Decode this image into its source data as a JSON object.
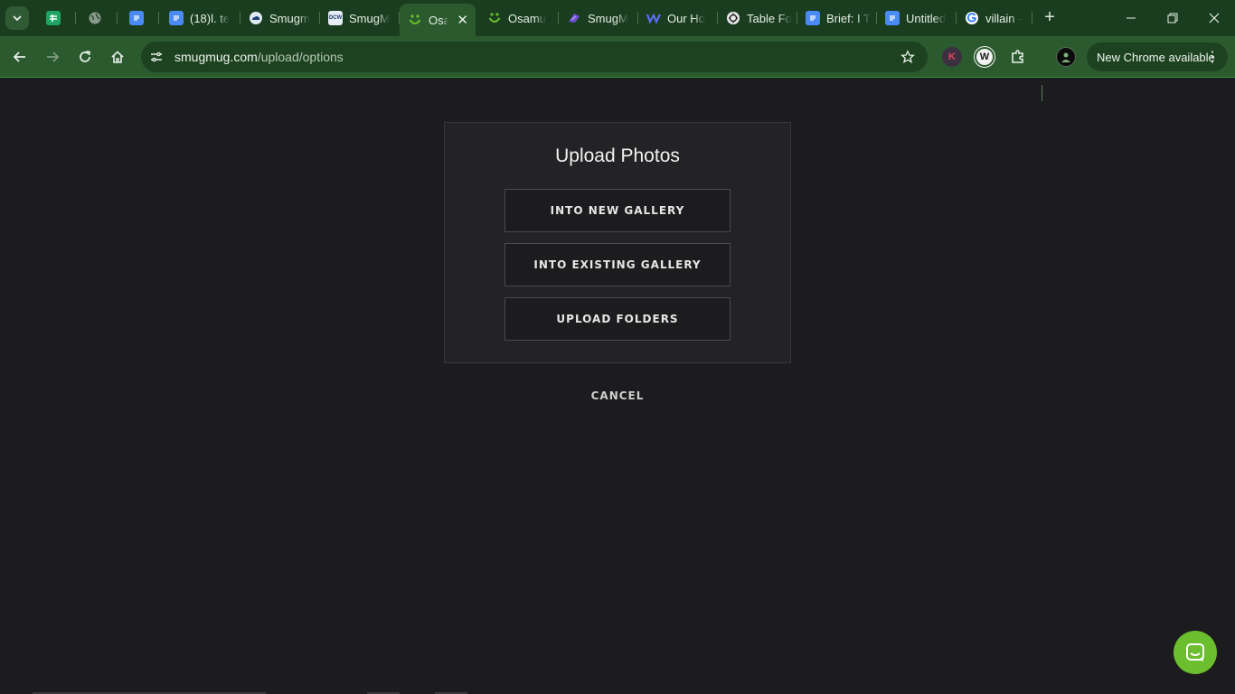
{
  "browser": {
    "tabs": [
      {
        "icon": "sheets-icon",
        "label": ""
      },
      {
        "icon": "globe-icon",
        "label": ""
      },
      {
        "icon": "docs-icon",
        "label": ""
      },
      {
        "icon": "docs-icon",
        "label": "(18)l. te"
      },
      {
        "icon": "cloud-icon",
        "label": "Smugm"
      },
      {
        "icon": "dcw-icon",
        "label": "SmugM"
      },
      {
        "icon": "smugmug-icon",
        "label": "Osa",
        "active": true
      },
      {
        "icon": "smugmug-icon",
        "label": "Osamu"
      },
      {
        "icon": "purple-logo-icon",
        "label": "SmugM"
      },
      {
        "icon": "w-logo-icon",
        "label": "Our Ho"
      },
      {
        "icon": "openai-icon",
        "label": "Table Fo"
      },
      {
        "icon": "docs-icon",
        "label": "Brief: I T"
      },
      {
        "icon": "docs-icon",
        "label": "Untitled"
      },
      {
        "icon": "google-icon",
        "label": "villain -"
      }
    ],
    "url_domain": "smugmug.com",
    "url_path": "/upload/options",
    "update_label": "New Chrome available",
    "ext_k_label": "K",
    "ext_w_label": "W"
  },
  "upload": {
    "title": "Upload Photos",
    "options": {
      "new_gallery": "INTO NEW GALLERY",
      "existing_gallery": "INTO EXISTING GALLERY",
      "folders": "UPLOAD FOLDERS"
    },
    "cancel": "CANCEL"
  },
  "colors": {
    "accent": "#6bbf2e",
    "frame": "#2b5a2f",
    "background": "#1c1c1e"
  }
}
